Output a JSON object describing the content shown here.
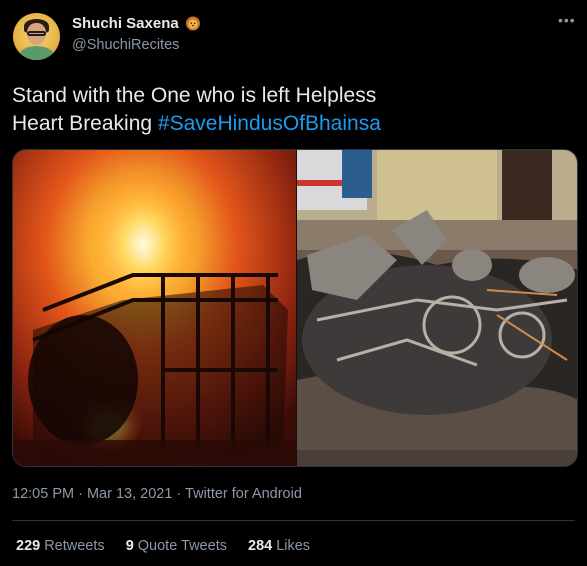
{
  "author": {
    "display_name": "Shuchi Saxena",
    "handle": "@ShuchiRecites",
    "badge_icon": "lion-face-icon"
  },
  "tweet": {
    "line1": "Stand with the One who is left Helpless",
    "line2_text": "Heart Breaking ",
    "hashtag": "#SaveHindusOfBhainsa"
  },
  "media": {
    "photos": [
      {
        "icon": "burning-vehicle-photo"
      },
      {
        "icon": "burnt-wreckage-photo"
      }
    ]
  },
  "meta": {
    "time": "12:05 PM",
    "sep1": " · ",
    "date": "Mar 13, 2021",
    "sep2": " · ",
    "source": "Twitter for Android"
  },
  "stats": {
    "retweets_count": "229",
    "retweets_label": "Retweets",
    "quotes_count": "9",
    "quotes_label": "Quote Tweets",
    "likes_count": "284",
    "likes_label": "Likes"
  },
  "colors": {
    "background": "#000000",
    "text": "#e7e9ea",
    "secondary": "#8b98a5",
    "link": "#1d9bf0",
    "border": "#2f3336"
  }
}
